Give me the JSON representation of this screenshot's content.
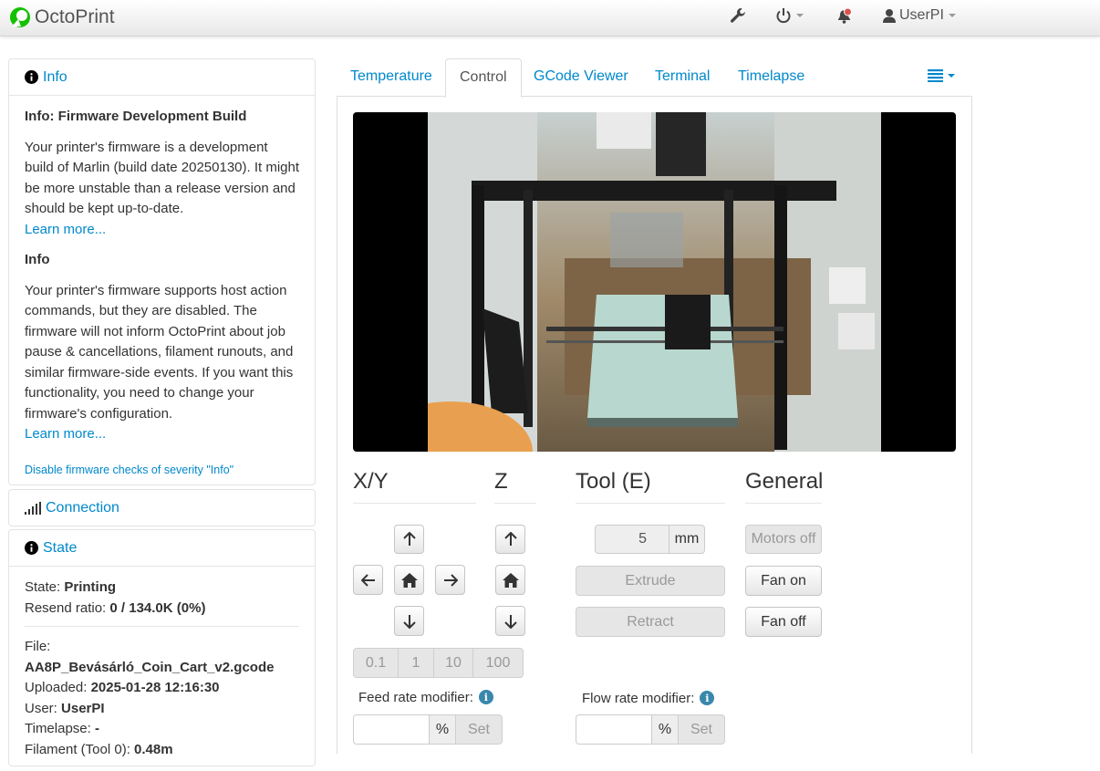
{
  "navbar": {
    "brand": "OctoPrint",
    "icons": [
      "wrench-icon",
      "power-icon",
      "bell-icon",
      "user-icon"
    ],
    "user": "UserPI"
  },
  "sidebar": {
    "info": {
      "title": "Info",
      "firmware_heading": "Info: Firmware Development Build",
      "firmware_text": "Your printer's firmware is a development build of Marlin (build date 20250130). It might be more unstable than a release version and should be kept up-to-date.",
      "learn_more_1": "Learn more...",
      "info_heading": "Info",
      "info_text": "Your printer's firmware supports host action commands, but they are disabled. The firmware will not inform OctoPrint about job pause & cancellations, filament runouts, and similar firmware-side events. If you want this functionality, you need to change your firmware's configuration.",
      "learn_more_2": "Learn more...",
      "disable_link": "Disable firmware checks of severity \"Info\""
    },
    "connection": {
      "title": "Connection"
    },
    "state": {
      "title": "State",
      "state_label": "State:",
      "state_value": "Printing",
      "resend_label": "Resend ratio:",
      "resend_value": "0 / 134.0K (0%)",
      "file_label": "File:",
      "file_value": "AA8P_Bevásárló_Coin_Cart_v2.gcode",
      "uploaded_label": "Uploaded:",
      "uploaded_value": "2025-01-28 12:16:30",
      "user_label": "User:",
      "user_value": "UserPI",
      "timelapse_label": "Timelapse:",
      "timelapse_value": "-",
      "filament_label": "Filament (Tool 0):",
      "filament_value": "0.48m"
    }
  },
  "tabs": [
    "Temperature",
    "Control",
    "GCode Viewer",
    "Terminal",
    "Timelapse"
  ],
  "active_tab": "Control",
  "control": {
    "xy_title": "X/Y",
    "z_title": "Z",
    "tool_title": "Tool (E)",
    "general_title": "General",
    "steps": [
      "0.1",
      "1",
      "10",
      "100"
    ],
    "extrude_amount": "5",
    "extrude_unit": "mm",
    "extrude_label": "Extrude",
    "retract_label": "Retract",
    "motors_off": "Motors off",
    "fan_on": "Fan on",
    "fan_off": "Fan off",
    "feed_rate_label": "Feed rate modifier:",
    "flow_rate_label": "Flow rate modifier:",
    "percent": "%",
    "set_label": "Set"
  },
  "colors": {
    "link": "#0088cc",
    "info_badge": "#3a87ad",
    "notification": "#d9534f"
  }
}
